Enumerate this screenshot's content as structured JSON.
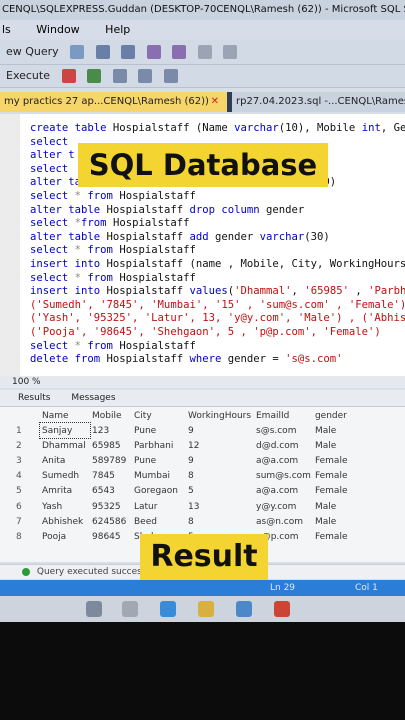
{
  "window": {
    "title": "CENQL\\SQLEXPRESS.Guddan (DESKTOP-70CENQL\\Ramesh (62)) - Microsoft SQL Serv"
  },
  "menu": [
    "ls",
    "Window",
    "Help"
  ],
  "toolbar": {
    "new_query": "ew Query",
    "execute": "Execute"
  },
  "tabs": {
    "active": "my practics 27 ap...CENQL\\Ramesh (62))",
    "inactive": "rp27.04.2023.sql -...CENQL\\Ramesh ("
  },
  "editor": {
    "lines": [
      [
        {
          "k": "create table",
          "c": "k"
        },
        {
          "k": " Hospialstaff (Name ",
          "c": "t"
        },
        {
          "k": "varchar",
          "c": "k"
        },
        {
          "k": "(10), Mobile ",
          "c": "t"
        },
        {
          "k": "int",
          "c": "k"
        },
        {
          "k": ", Gen",
          "c": "t"
        }
      ],
      [
        {
          "k": "select",
          "c": "k"
        }
      ],
      [
        {
          "k": "alter t",
          "c": "k"
        }
      ],
      [
        {
          "k": "select",
          "c": "k"
        }
      ],
      [
        {
          "k": "alter table",
          "c": "k"
        },
        {
          "k": " Hospialstaff ",
          "c": "t"
        },
        {
          "k": "add",
          "c": "k"
        },
        {
          "k": " EmailId ",
          "c": "t"
        },
        {
          "k": "varchar",
          "c": "k"
        },
        {
          "k": "(30)",
          "c": "t"
        }
      ],
      [
        {
          "k": "select",
          "c": "k"
        },
        {
          "k": " * ",
          "c": "g"
        },
        {
          "k": "from",
          "c": "k"
        },
        {
          "k": " Hospialstaff",
          "c": "t"
        }
      ],
      [
        {
          "k": "alter table",
          "c": "k"
        },
        {
          "k": " Hospialstaff ",
          "c": "t"
        },
        {
          "k": "drop column",
          "c": "k"
        },
        {
          "k": " gender",
          "c": "t"
        }
      ],
      [
        {
          "k": "select",
          "c": "k"
        },
        {
          "k": " *",
          "c": "g"
        },
        {
          "k": "from",
          "c": "k"
        },
        {
          "k": " Hospialstaff",
          "c": "t"
        }
      ],
      [
        {
          "k": "alter table",
          "c": "k"
        },
        {
          "k": " Hospialstaff ",
          "c": "t"
        },
        {
          "k": "add",
          "c": "k"
        },
        {
          "k": " gender ",
          "c": "t"
        },
        {
          "k": "varchar",
          "c": "k"
        },
        {
          "k": "(30)",
          "c": "t"
        }
      ],
      [
        {
          "k": "select",
          "c": "k"
        },
        {
          "k": " * ",
          "c": "g"
        },
        {
          "k": "from",
          "c": "k"
        },
        {
          "k": " Hospialstaff",
          "c": "t"
        }
      ],
      [
        {
          "k": "insert into",
          "c": "k"
        },
        {
          "k": " Hospialstaff (name , Mobile, City, WorkingHours, e",
          "c": "t"
        }
      ],
      [
        {
          "k": "select",
          "c": "k"
        },
        {
          "k": " * ",
          "c": "g"
        },
        {
          "k": "from",
          "c": "k"
        },
        {
          "k": " Hospialstaff",
          "c": "t"
        }
      ],
      [
        {
          "k": "insert into",
          "c": "k"
        },
        {
          "k": " Hospialstaff ",
          "c": "t"
        },
        {
          "k": "values",
          "c": "k"
        },
        {
          "k": "(",
          "c": "t"
        },
        {
          "k": "'Dhammal'",
          "c": "s"
        },
        {
          "k": ", ",
          "c": "t"
        },
        {
          "k": "'65985'",
          "c": "s"
        },
        {
          "k": " , ",
          "c": "t"
        },
        {
          "k": "'Parbhani",
          "c": "s"
        }
      ],
      [
        {
          "k": "('Sumedh', '7845', 'Mumbai', '15' , 'sum@s.com' , 'Female') ,",
          "c": "s"
        }
      ],
      [
        {
          "k": "('Yash', '95325', 'Latur', 13, 'y@y.com', 'Male') , ('Abhishek",
          "c": "s"
        }
      ],
      [
        {
          "k": "('Pooja', '98645', 'Shehgaon', 5 , 'p@p.com', 'Female')",
          "c": "s"
        }
      ],
      [
        {
          "k": "select",
          "c": "k"
        },
        {
          "k": " * ",
          "c": "g"
        },
        {
          "k": "from",
          "c": "k"
        },
        {
          "k": " Hospialstaff",
          "c": "t"
        }
      ],
      [
        {
          "k": "delete from",
          "c": "k"
        },
        {
          "k": " Hospialstaff ",
          "c": "t"
        },
        {
          "k": "where",
          "c": "k"
        },
        {
          "k": " gender = ",
          "c": "t"
        },
        {
          "k": "'s@s.com'",
          "c": "s"
        }
      ]
    ]
  },
  "zoom": "100 %",
  "results_tabs": [
    "Results",
    "Messages"
  ],
  "grid": {
    "columns": [
      "Name",
      "Mobile",
      "City",
      "WorkingHours",
      "EmailId",
      "gender"
    ],
    "rows": [
      [
        "1",
        "Sanjay",
        "123",
        "Pune",
        "9",
        "s@s.com",
        "Male"
      ],
      [
        "2",
        "Dhammal",
        "65985",
        "Parbhani",
        "12",
        "d@d.com",
        "Male"
      ],
      [
        "3",
        "Anita",
        "589789",
        "Pune",
        "9",
        "a@a.com",
        "Female"
      ],
      [
        "4",
        "Sumedh",
        "7845",
        "Mumbai",
        "8",
        "sum@s.com",
        "Female"
      ],
      [
        "5",
        "Amrita",
        "6543",
        "Goregaon",
        "5",
        "a@a.com",
        "Female"
      ],
      [
        "6",
        "Yash",
        "95325",
        "Latur",
        "13",
        "y@y.com",
        "Male"
      ],
      [
        "7",
        "Abhishek",
        "624586",
        "Beed",
        "8",
        "as@n.com",
        "Male"
      ],
      [
        "8",
        "Pooja",
        "98645",
        "Shehgaon",
        "5",
        "p@p.com",
        "Female"
      ]
    ]
  },
  "status": {
    "message": "Query executed success",
    "ln": "Ln 29",
    "col": "Col 1"
  },
  "overlays": {
    "title": "SQL Database",
    "result": "Result"
  },
  "colors": {
    "keyword": "#0000cc",
    "string": "#c01010",
    "overlay": "#f3d431",
    "tab_active": "#f6d56b",
    "statusbar": "#2b7ed8"
  }
}
